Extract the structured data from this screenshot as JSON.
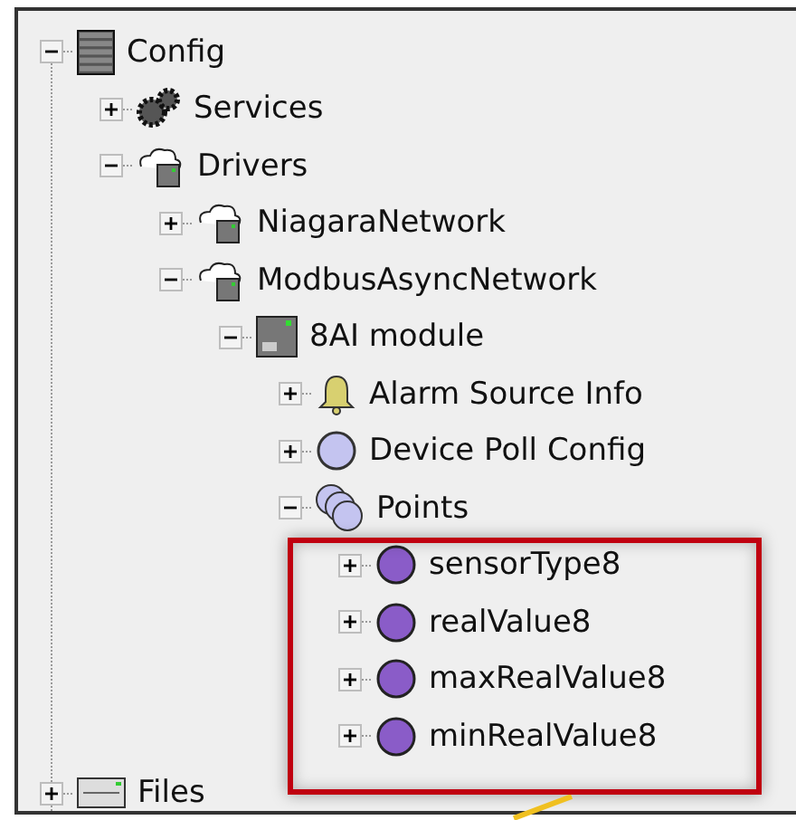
{
  "tree": [
    {
      "label": "Config",
      "kind": "database",
      "expanded": true,
      "children": [
        {
          "label": "Services",
          "kind": "gears",
          "expanded": false
        },
        {
          "label": "Drivers",
          "kind": "network",
          "expanded": true,
          "children": [
            {
              "label": "NiagaraNetwork",
              "kind": "network",
              "expanded": false
            },
            {
              "label": "ModbusAsyncNetwork",
              "kind": "network",
              "expanded": true,
              "children": [
                {
                  "label": "8AI module",
                  "kind": "device",
                  "expanded": true,
                  "children": [
                    {
                      "label": "Alarm Source Info",
                      "kind": "bell",
                      "expanded": false
                    },
                    {
                      "label": "Device Poll Config",
                      "kind": "circle",
                      "expanded": false
                    },
                    {
                      "label": "Points",
                      "kind": "points",
                      "expanded": true,
                      "children": [
                        {
                          "label": "sensorType8",
                          "kind": "point",
                          "expanded": false
                        },
                        {
                          "label": "realValue8",
                          "kind": "point",
                          "expanded": false
                        },
                        {
                          "label": "maxRealValue8",
                          "kind": "point",
                          "expanded": false
                        },
                        {
                          "label": "minRealValue8",
                          "kind": "point",
                          "expanded": false
                        }
                      ]
                    }
                  ]
                }
              ]
            }
          ]
        }
      ]
    },
    {
      "label": "Files",
      "kind": "files",
      "expanded": false
    }
  ]
}
